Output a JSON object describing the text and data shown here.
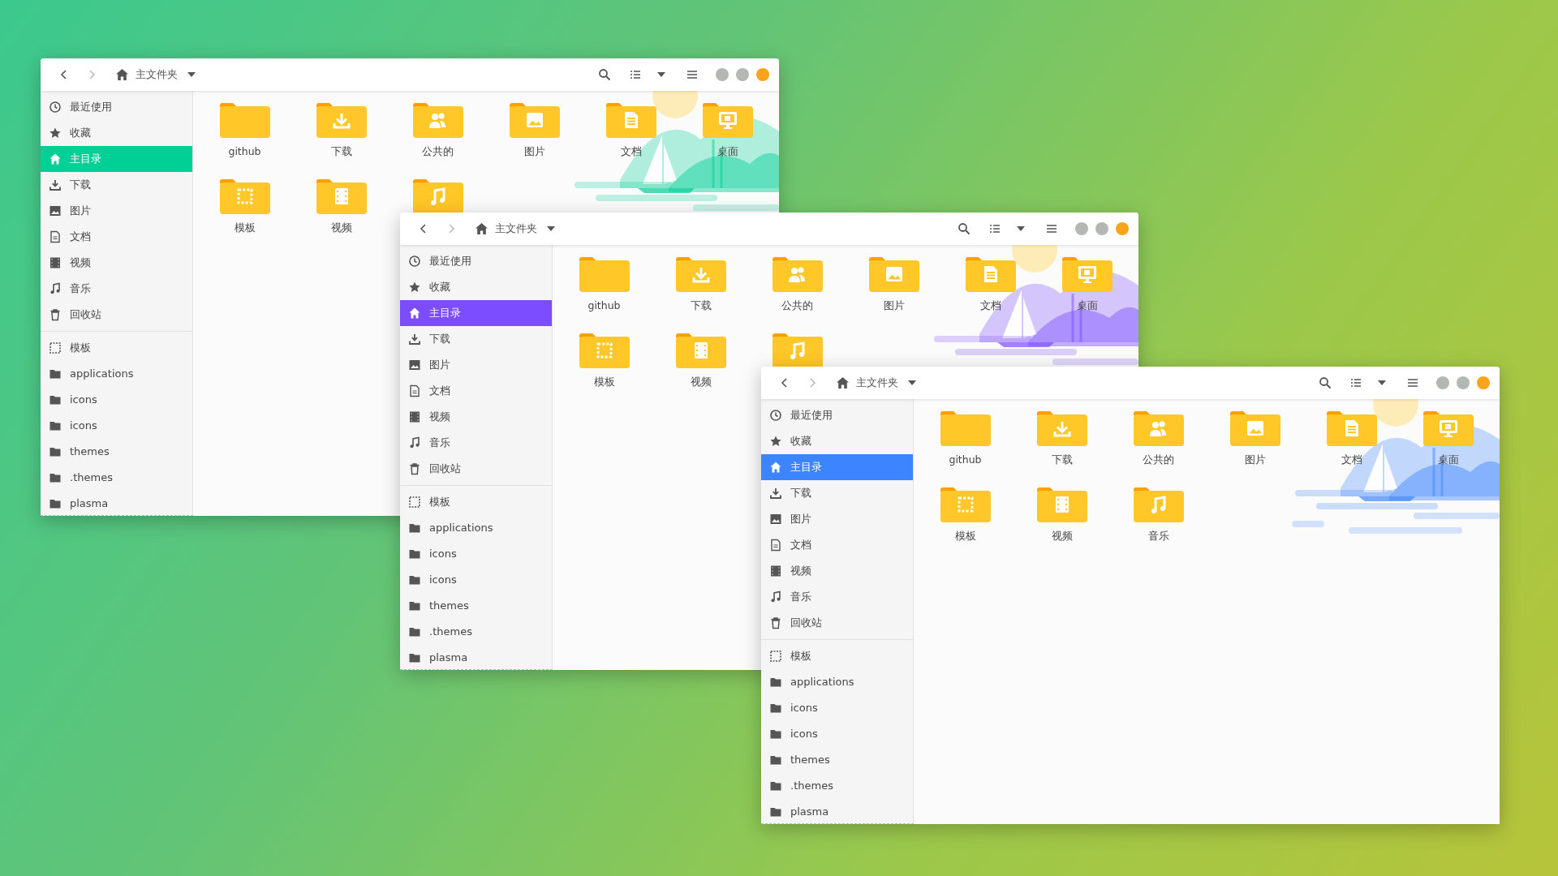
{
  "windows": [
    {
      "color": "#00cf96",
      "path": "主文件夹",
      "nav": [
        {
          "kind": "back",
          "disabled": false
        },
        {
          "kind": "forward",
          "disabled": true
        }
      ],
      "window_controls": [
        {
          "color": "#b4b8b4"
        },
        {
          "color": "#b4b8b4"
        },
        {
          "color": "#faa419"
        }
      ],
      "places": [
        {
          "kind": "recent",
          "label": "最近使用",
          "selected": false
        },
        {
          "kind": "starred",
          "label": "收藏",
          "selected": false
        },
        {
          "kind": "home",
          "label": "主目录",
          "selected": true
        },
        {
          "kind": "downloads",
          "label": "下载",
          "selected": false
        },
        {
          "kind": "pictures",
          "label": "图片",
          "selected": false
        },
        {
          "kind": "documents",
          "label": "文档",
          "selected": false
        },
        {
          "kind": "videos",
          "label": "视频",
          "selected": false
        },
        {
          "kind": "music",
          "label": "音乐",
          "selected": false
        },
        {
          "kind": "trash",
          "label": "回收站",
          "selected": false
        }
      ],
      "bookmarks": [
        {
          "kind": "template",
          "label": "模板",
          "selected": false
        },
        {
          "kind": "folder",
          "label": "applications",
          "selected": false
        },
        {
          "kind": "folder",
          "label": "icons",
          "selected": false
        },
        {
          "kind": "folder",
          "label": "icons",
          "selected": false
        },
        {
          "kind": "folder",
          "label": "themes",
          "selected": false
        },
        {
          "kind": "folder",
          "label": ".themes",
          "selected": false
        },
        {
          "kind": "folder",
          "label": "plasma",
          "selected": false
        }
      ],
      "files": [
        {
          "kind": "plain",
          "label": "github"
        },
        {
          "kind": "download",
          "label": "下载"
        },
        {
          "kind": "users",
          "label": "公共的"
        },
        {
          "kind": "picture",
          "label": "图片"
        },
        {
          "kind": "document",
          "label": "文档"
        },
        {
          "kind": "desktop",
          "label": "桌面"
        },
        {
          "kind": "template",
          "label": "模板"
        },
        {
          "kind": "video",
          "label": "视频"
        },
        {
          "kind": "music"
        }
      ]
    },
    {
      "color": "#7c4dff",
      "path": "主文件夹",
      "nav": [
        {
          "kind": "back",
          "disabled": false
        },
        {
          "kind": "forward",
          "disabled": true
        }
      ],
      "window_controls": [
        {
          "color": "#b4b8b4"
        },
        {
          "color": "#b4b8b4"
        },
        {
          "color": "#faa419"
        }
      ],
      "places": [
        {
          "kind": "recent",
          "label": "最近使用",
          "selected": false
        },
        {
          "kind": "starred",
          "label": "收藏",
          "selected": false
        },
        {
          "kind": "home",
          "label": "主目录",
          "selected": true
        },
        {
          "kind": "downloads",
          "label": "下载",
          "selected": false
        },
        {
          "kind": "pictures",
          "label": "图片",
          "selected": false
        },
        {
          "kind": "documents",
          "label": "文档",
          "selected": false
        },
        {
          "kind": "videos",
          "label": "视频",
          "selected": false
        },
        {
          "kind": "music",
          "label": "音乐",
          "selected": false
        },
        {
          "kind": "trash",
          "label": "回收站",
          "selected": false
        }
      ],
      "bookmarks": [
        {
          "kind": "template",
          "label": "模板",
          "selected": false
        },
        {
          "kind": "folder",
          "label": "applications",
          "selected": false
        },
        {
          "kind": "folder",
          "label": "icons",
          "selected": false
        },
        {
          "kind": "folder",
          "label": "icons",
          "selected": false
        },
        {
          "kind": "folder",
          "label": "themes",
          "selected": false
        },
        {
          "kind": "folder",
          "label": ".themes",
          "selected": false
        },
        {
          "kind": "folder",
          "label": "plasma",
          "selected": false
        }
      ],
      "files": [
        {
          "kind": "plain",
          "label": "github"
        },
        {
          "kind": "download",
          "label": "下载"
        },
        {
          "kind": "users",
          "label": "公共的"
        },
        {
          "kind": "picture",
          "label": "图片"
        },
        {
          "kind": "document",
          "label": "文档"
        },
        {
          "kind": "desktop",
          "label": "桌面"
        },
        {
          "kind": "template",
          "label": "模板"
        },
        {
          "kind": "video",
          "label": "视频"
        },
        {
          "kind": "music"
        }
      ]
    },
    {
      "color": "#3d85ff",
      "path": "主文件夹",
      "nav": [
        {
          "kind": "back",
          "disabled": false
        },
        {
          "kind": "forward",
          "disabled": true
        }
      ],
      "window_controls": [
        {
          "color": "#b4b8b4"
        },
        {
          "color": "#b4b8b4"
        },
        {
          "color": "#faa419"
        }
      ],
      "places": [
        {
          "kind": "recent",
          "label": "最近使用",
          "selected": false
        },
        {
          "kind": "starred",
          "label": "收藏",
          "selected": false
        },
        {
          "kind": "home",
          "label": "主目录",
          "selected": true
        },
        {
          "kind": "downloads",
          "label": "下载",
          "selected": false
        },
        {
          "kind": "pictures",
          "label": "图片",
          "selected": false
        },
        {
          "kind": "documents",
          "label": "文档",
          "selected": false
        },
        {
          "kind": "videos",
          "label": "视频",
          "selected": false
        },
        {
          "kind": "music",
          "label": "音乐",
          "selected": false
        },
        {
          "kind": "trash",
          "label": "回收站",
          "selected": false
        }
      ],
      "bookmarks": [
        {
          "kind": "template",
          "label": "模板",
          "selected": false
        },
        {
          "kind": "folder",
          "label": "applications",
          "selected": false
        },
        {
          "kind": "folder",
          "label": "icons",
          "selected": false
        },
        {
          "kind": "folder",
          "label": "icons",
          "selected": false
        },
        {
          "kind": "folder",
          "label": "themes",
          "selected": false
        },
        {
          "kind": "folder",
          "label": ".themes",
          "selected": false
        },
        {
          "kind": "folder",
          "label": "plasma",
          "selected": false
        }
      ],
      "files": [
        {
          "kind": "plain",
          "label": "github"
        },
        {
          "kind": "download",
          "label": "下载"
        },
        {
          "kind": "users",
          "label": "公共的"
        },
        {
          "kind": "picture",
          "label": "图片"
        },
        {
          "kind": "document",
          "label": "文档"
        },
        {
          "kind": "desktop",
          "label": "桌面"
        },
        {
          "kind": "template",
          "label": "模板"
        },
        {
          "kind": "video",
          "label": "视频"
        },
        {
          "kind": "music",
          "label": "音乐"
        }
      ]
    }
  ]
}
